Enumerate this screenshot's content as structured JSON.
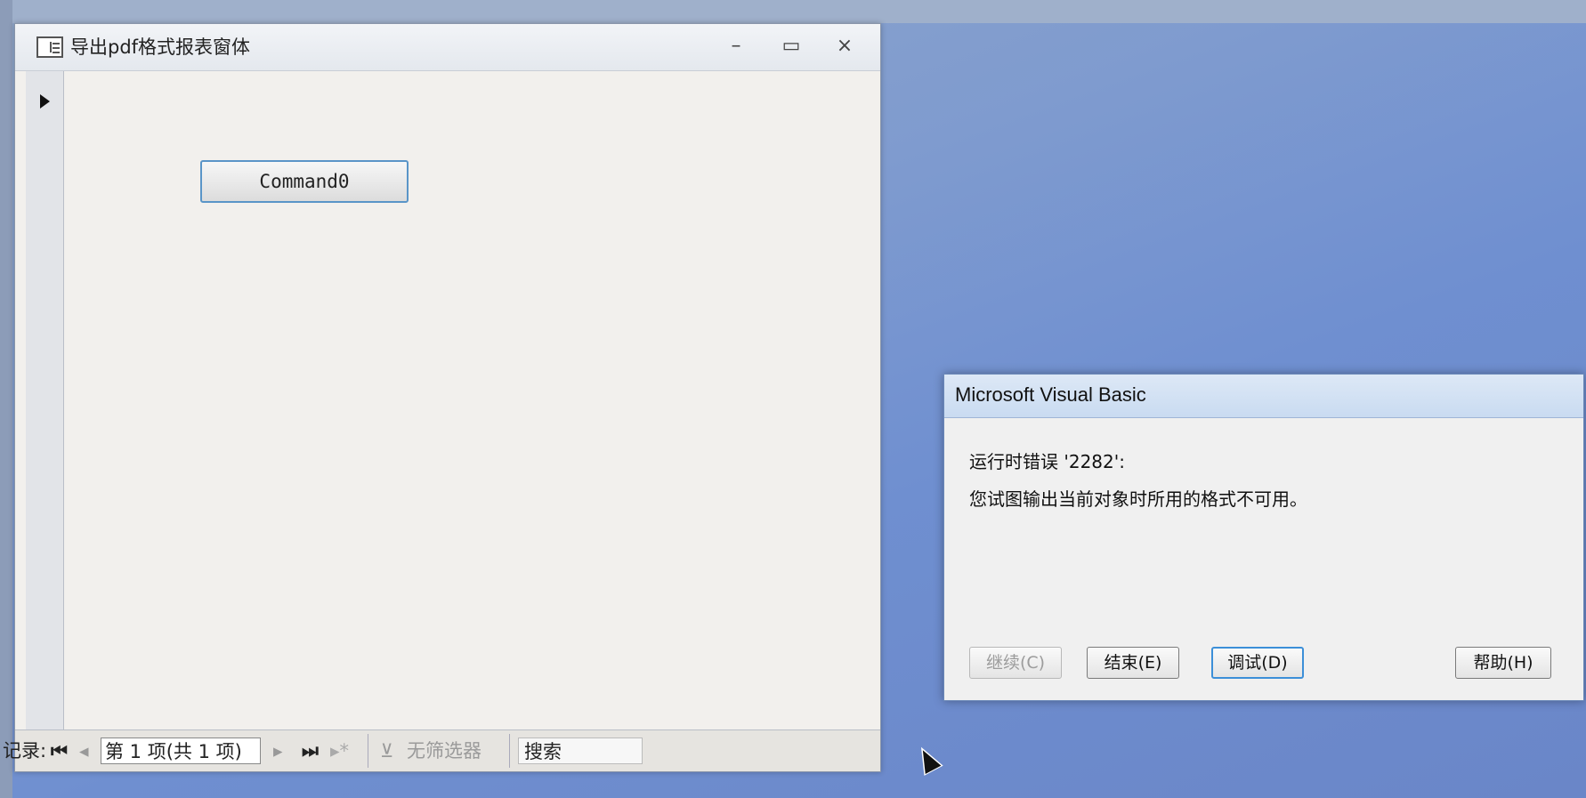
{
  "form_window": {
    "title": "导出pdf格式报表窗体",
    "minimize": "–",
    "maximize": "▭",
    "close": "×",
    "command_button": "Command0"
  },
  "nav_bar": {
    "record_label": "记录:",
    "first": "⏮",
    "prev": "◂",
    "current": "第 1 项(共 1 项)",
    "next": "▸",
    "last": "⏭",
    "new": "▸*",
    "filter_icon": "⊻",
    "filter_text": "无筛选器",
    "search": "搜索"
  },
  "vb_dialog": {
    "title": "Microsoft Visual Basic",
    "error_line": "运行时错误 '2282':",
    "message": "您试图输出当前对象时所用的格式不可用。",
    "buttons": {
      "continue": "继续(C)",
      "end": "结束(E)",
      "debug": "调试(D)",
      "help": "帮助(H)"
    }
  }
}
